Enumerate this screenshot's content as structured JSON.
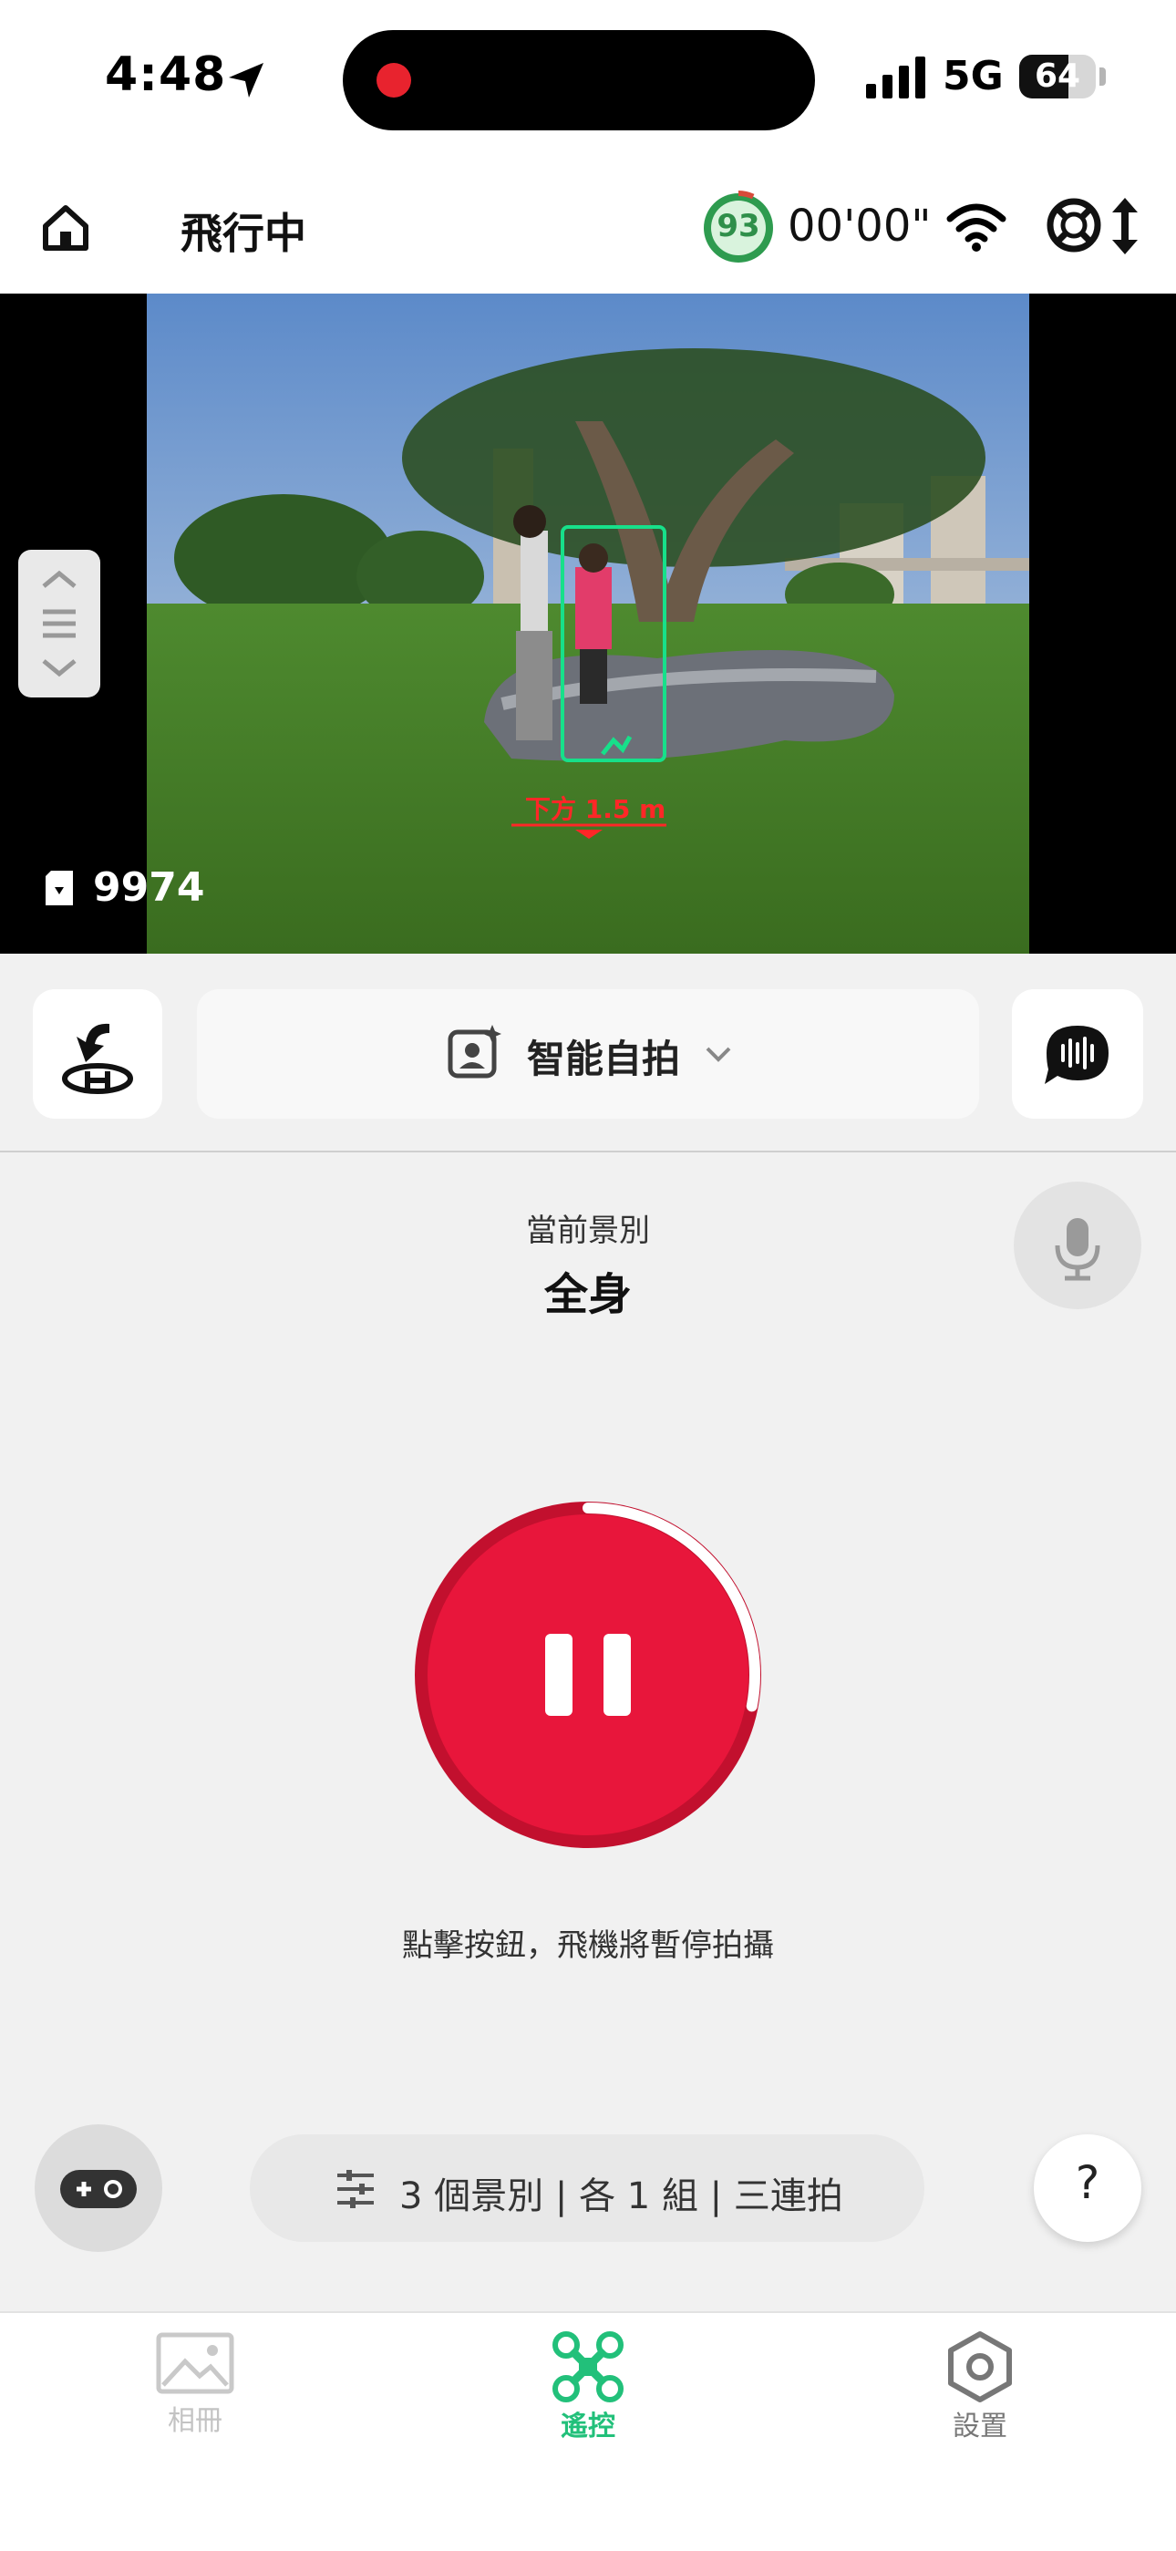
{
  "status_bar": {
    "time": "4:48",
    "network": "5G",
    "battery_level": "64",
    "battery_fraction": 0.64
  },
  "header": {
    "flight_status": "飛行中",
    "drone_battery": "93",
    "drone_battery_fraction": 0.93,
    "timer": "00'00\""
  },
  "camera": {
    "remaining_photos": "9974",
    "subject_distance": "下方 1.5 m"
  },
  "controls": {
    "mode_label": "智能自拍"
  },
  "shot": {
    "caption": "當前景別",
    "value": "全身",
    "hint": "點擊按鈕，飛機將暫停拍攝",
    "progress_fraction": 0.28
  },
  "options": {
    "summary": "3 個景別 | 各 1 組 | 三連拍",
    "help": "?"
  },
  "tabs": [
    {
      "label": "相冊",
      "active": false
    },
    {
      "label": "遙控",
      "active": true
    },
    {
      "label": "設置",
      "active": false
    }
  ],
  "colors": {
    "accent_red": "#e8163b",
    "active_tab": "#22c07a",
    "battery_green": "#2f8f4a"
  },
  "icons": [
    "home-icon",
    "wifi-icon",
    "lifesaver-icon",
    "altitude-arrows-icon",
    "location-icon",
    "signal-icon",
    "sd-card-icon",
    "return-home-icon",
    "selfie-icon",
    "chevron-down-icon",
    "voice-chat-icon",
    "microphone-icon",
    "pause-icon",
    "gamepad-icon",
    "sliders-icon",
    "album-icon",
    "drone-icon",
    "settings-icon"
  ]
}
